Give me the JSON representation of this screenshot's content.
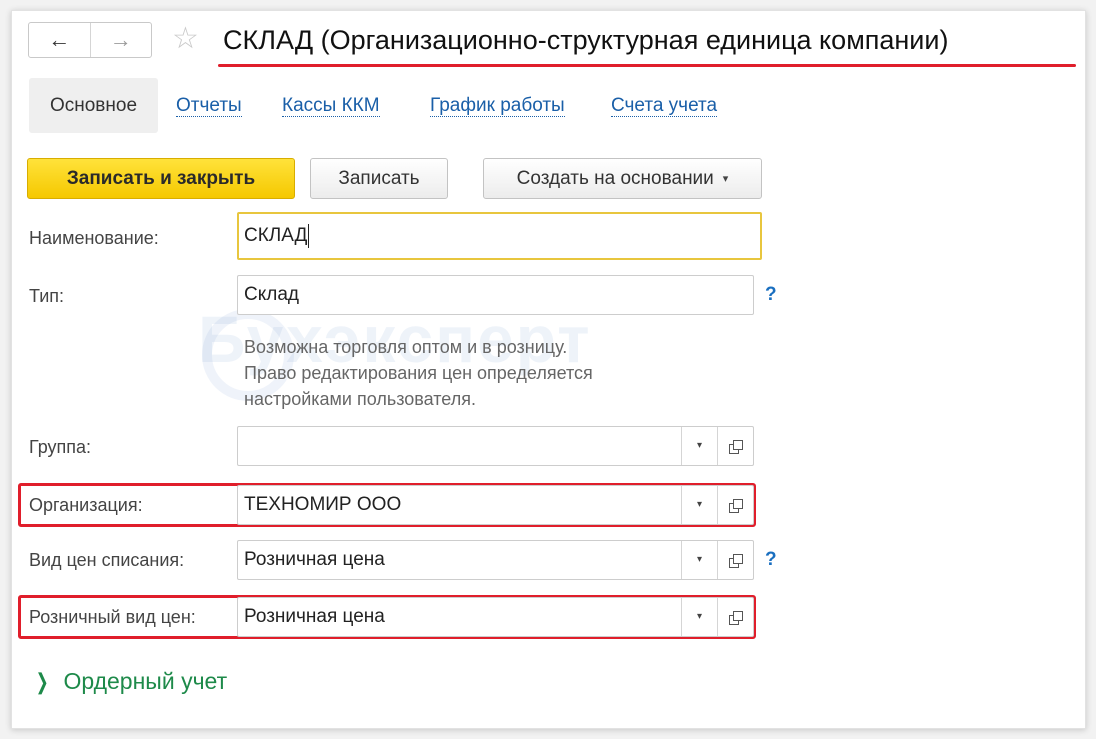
{
  "header": {
    "back_icon": "←",
    "forward_icon": "→",
    "star_icon": "☆",
    "title": "СКЛАД (Организационно-структурная единица компании)"
  },
  "tabs": [
    {
      "label": "Основное"
    },
    {
      "label": "Отчеты"
    },
    {
      "label": "Кассы ККМ"
    },
    {
      "label": "График работы"
    },
    {
      "label": "Счета учета"
    }
  ],
  "toolbar": {
    "save_close_label": "Записать и закрыть",
    "save_label": "Записать",
    "create_based_label": "Создать на основании",
    "caret": "▾"
  },
  "form": {
    "name": {
      "label": "Наименование:",
      "value": "СКЛАД"
    },
    "type": {
      "label": "Тип:",
      "value": "Склад",
      "help": "?"
    },
    "hint": [
      "Возможна торговля оптом и в розницу.",
      "Право редактирования цен определяется",
      "настройками пользователя."
    ],
    "group": {
      "label": "Группа:",
      "value": ""
    },
    "organization": {
      "label": "Организация:",
      "value": "ТЕХНОМИР ООО"
    },
    "writeoff_price": {
      "label": "Вид цен списания:",
      "value": "Розничная цена",
      "help": "?"
    },
    "retail_price": {
      "label": "Розничный вид цен:",
      "value": "Розничная цена"
    },
    "drop_icon": "▾"
  },
  "section": {
    "chevron": "❯",
    "label": "Ордерный учет"
  },
  "watermark": "Бухэксперт",
  "colors": {
    "accent_yellow": "#f5c800",
    "link_blue": "#1a5fa8",
    "highlight_red": "#e01e2b",
    "section_green": "#1e8a4a"
  }
}
